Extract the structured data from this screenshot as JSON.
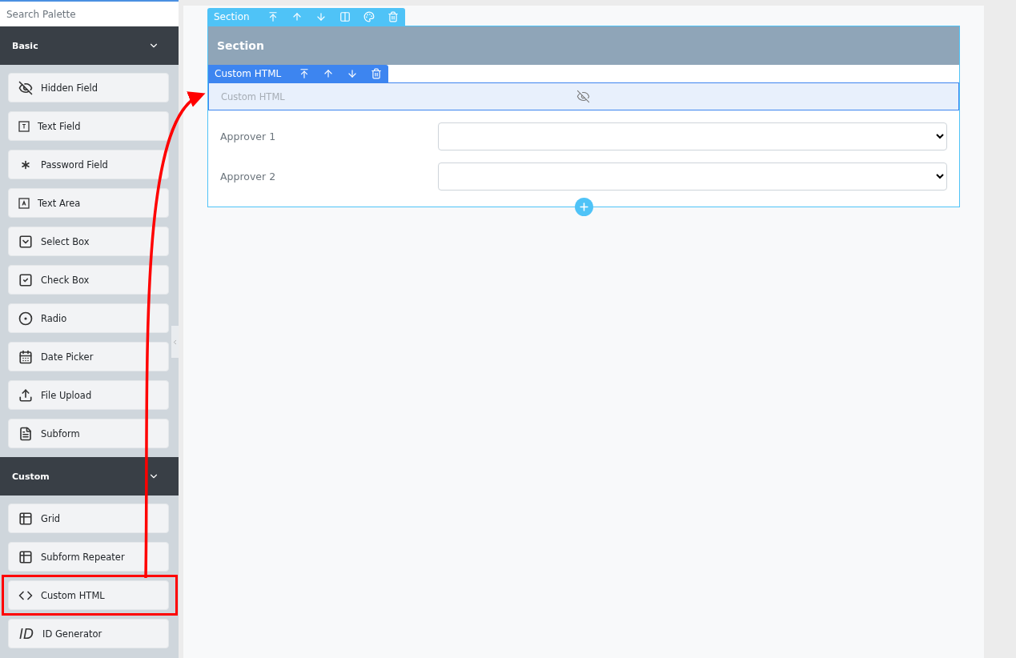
{
  "palette": {
    "search": {
      "placeholder": "Search Palette"
    },
    "groups": [
      {
        "title": "Basic",
        "expanded": true,
        "items": [
          {
            "label": "Hidden Field",
            "highlighted": false
          },
          {
            "label": "Text Field",
            "highlighted": false
          },
          {
            "label": "Password Field",
            "highlighted": false
          },
          {
            "label": "Text Area",
            "highlighted": false
          },
          {
            "label": "Select Box",
            "highlighted": false
          },
          {
            "label": "Check Box",
            "highlighted": false
          },
          {
            "label": "Radio",
            "highlighted": false
          },
          {
            "label": "Date Picker",
            "highlighted": false
          },
          {
            "label": "File Upload",
            "highlighted": false
          },
          {
            "label": "Subform",
            "highlighted": false
          }
        ]
      },
      {
        "title": "Custom",
        "expanded": true,
        "items": [
          {
            "label": "Grid",
            "highlighted": false
          },
          {
            "label": "Subform Repeater",
            "highlighted": false
          },
          {
            "label": "Custom HTML",
            "highlighted": true
          },
          {
            "label": "ID Generator",
            "glyph": "ID",
            "highlighted": false
          }
        ]
      }
    ]
  },
  "canvas": {
    "section": {
      "toolbar_label": "Section",
      "title": "Section",
      "custom_html": {
        "toolbar_label": "Custom HTML",
        "placeholder": "Custom HTML",
        "hidden": true
      },
      "fields": [
        {
          "label": "Approver 1"
        },
        {
          "label": "Approver 2"
        }
      ]
    }
  },
  "annotation": {
    "arrow": true
  }
}
